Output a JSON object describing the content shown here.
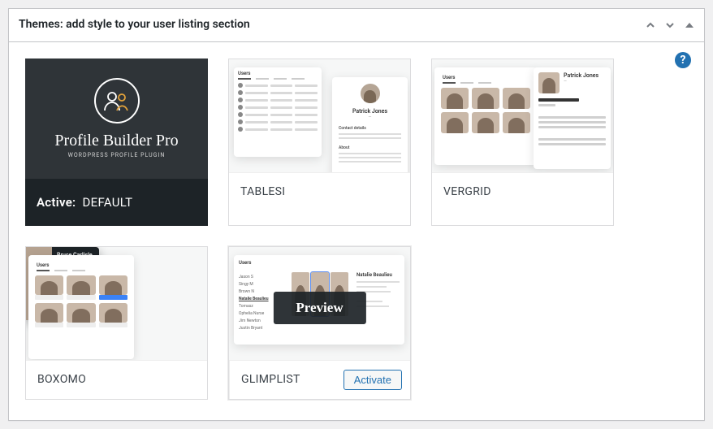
{
  "panel": {
    "title": "Themes: add style to your user listing section",
    "help_icon_label": "?",
    "collapse_tooltip": "Toggle panel",
    "move_up_tooltip": "Move up",
    "move_down_tooltip": "Move down"
  },
  "active_theme": {
    "screenshot": {
      "brand_title": "Profile Builder Pro",
      "brand_subtitle": "WORDPRESS PROFILE PLUGIN"
    },
    "label_prefix": "Active:",
    "name": "DEFAULT"
  },
  "themes": [
    {
      "id": "tablesi",
      "name": "TABLESI",
      "mock_profile_name": "Patrick Jones"
    },
    {
      "id": "vergrid",
      "name": "VERGRID",
      "mock_profile_name": "Patrick Jones"
    },
    {
      "id": "boxomo",
      "name": "BOXOMO",
      "mock_profile_name": "Bruce Carlisle"
    },
    {
      "id": "glimplist",
      "name": "GLIMPLIST",
      "mock_profile_name": "Natalie Beaulieu",
      "hovered": true
    }
  ],
  "hover": {
    "preview_label": "Preview",
    "activate_label": "Activate"
  },
  "glimplist_names": [
    "Jason S",
    "Singy M",
    "Brown N",
    "Natalie Beaulieu",
    "Tomasz",
    "Ophelia Nurse",
    "Jim Newton",
    "Justin Bryant"
  ],
  "mock_ui": {
    "list_header": "Users"
  }
}
